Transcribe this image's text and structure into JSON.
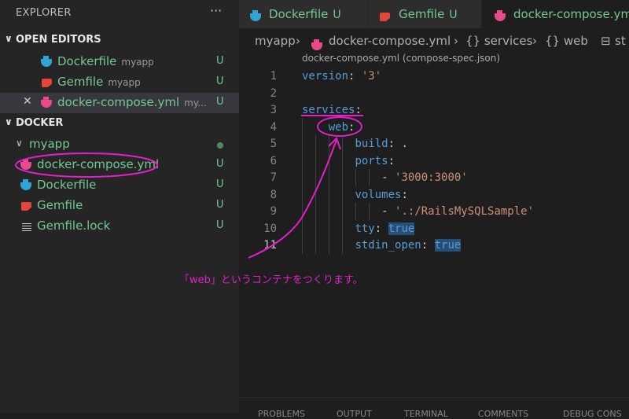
{
  "explorer": {
    "title": "EXPLORER",
    "more": "···",
    "open_editors_label": "OPEN EDITORS",
    "open_editors": [
      {
        "name": "Dockerfile",
        "dir": "myapp",
        "status": "U",
        "icon": "docker-icon"
      },
      {
        "name": "Gemfile",
        "dir": "myapp",
        "status": "U",
        "icon": "ruby-gem-icon"
      },
      {
        "name": "docker-compose.yml",
        "dir": "my...",
        "status": "U",
        "icon": "docker-compose-icon"
      }
    ],
    "docker_label": "DOCKER",
    "folder": "myapp",
    "files": [
      {
        "name": "docker-compose.yml",
        "status": "U"
      },
      {
        "name": "Dockerfile",
        "status": "U"
      },
      {
        "name": "Gemfile",
        "status": "U"
      },
      {
        "name": "Gemfile.lock",
        "status": "U"
      }
    ]
  },
  "tabs": [
    {
      "name": "Dockerfile",
      "status": "U"
    },
    {
      "name": "Gemfile",
      "status": "U"
    },
    {
      "name": "docker-compose.ym",
      "status": ""
    }
  ],
  "breadcrumb": [
    "myapp",
    "docker-compose.yml",
    "{} services",
    "{} web",
    "st"
  ],
  "schema_hint": "docker-compose.yml (compose-spec.json)",
  "line_numbers": [
    "1",
    "2",
    "3",
    "4",
    "5",
    "6",
    "7",
    "8",
    "9",
    "10",
    "11"
  ],
  "code": {
    "l1_key": "version",
    "l1_val": "'3'",
    "l3_key": "services",
    "l4_key": "web",
    "l5_key": "build",
    "l5_val": ".",
    "l6_key": "ports",
    "l7_val": "'3000:3000'",
    "l8_key": "volumes",
    "l9_val": "'.:/RailsMySQLSample'",
    "l10_key": "tty",
    "l10_val": "true",
    "l11_key": "stdin_open",
    "l11_val": "true"
  },
  "bottom_panel": [
    "PROBLEMS",
    "OUTPUT",
    "TERMINAL",
    "COMMENTS",
    "DEBUG CONS"
  ],
  "annotation": "「web」というコンテナをつくります。",
  "colors": {
    "annotation": "#e020c8",
    "untracked": "#73c991",
    "keyword": "#569cd6",
    "string": "#ce9178"
  }
}
